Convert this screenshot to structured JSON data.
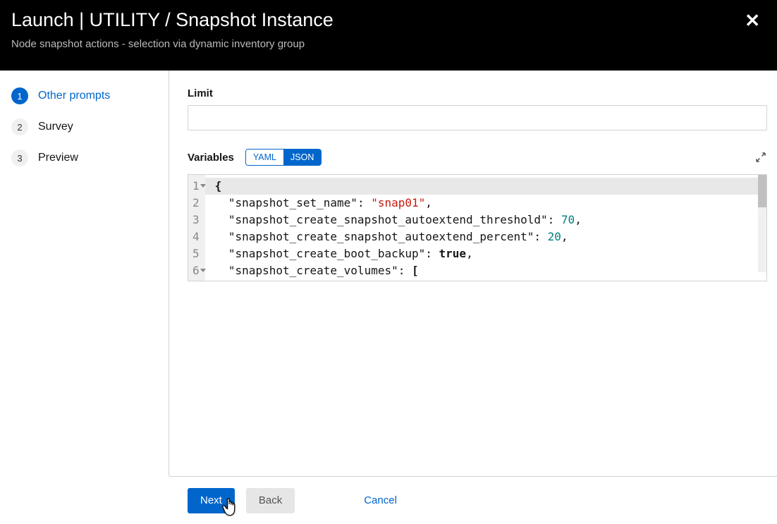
{
  "header": {
    "title": "Launch | UTILITY / Snapshot Instance",
    "subtitle": "Node snapshot actions - selection via dynamic inventory group",
    "close_icon": "✕"
  },
  "sidebar": {
    "steps": [
      {
        "num": "1",
        "label": "Other prompts",
        "active": true
      },
      {
        "num": "2",
        "label": "Survey",
        "active": false
      },
      {
        "num": "3",
        "label": "Preview",
        "active": false
      }
    ]
  },
  "fields": {
    "limit_label": "Limit",
    "limit_value": "",
    "variables_label": "Variables",
    "toggle_yaml": "YAML",
    "toggle_json": "JSON"
  },
  "chart_data": {
    "type": "table",
    "title": "Variables JSON editor",
    "language": "json",
    "raw": "{\n  \"snapshot_set_name\": \"snap01\",\n  \"snapshot_create_snapshot_autoextend_threshold\": 70,\n  \"snapshot_create_snapshot_autoextend_percent\": 20,\n  \"snapshot_create_boot_backup\": true,\n  \"snapshot_create_volumes\": [",
    "lines": [
      {
        "n": 1,
        "fold": true,
        "tokens": [
          {
            "t": "punct",
            "v": "{"
          }
        ]
      },
      {
        "n": 2,
        "fold": false,
        "tokens": [
          {
            "t": "indent",
            "v": "  "
          },
          {
            "t": "str-key",
            "v": "\"snapshot_set_name\""
          },
          {
            "t": "plain",
            "v": ": "
          },
          {
            "t": "str-val",
            "v": "\"snap01\""
          },
          {
            "t": "plain",
            "v": ","
          }
        ]
      },
      {
        "n": 3,
        "fold": false,
        "tokens": [
          {
            "t": "indent",
            "v": "  "
          },
          {
            "t": "str-key",
            "v": "\"snapshot_create_snapshot_autoextend_threshold\""
          },
          {
            "t": "plain",
            "v": ": "
          },
          {
            "t": "num",
            "v": "70"
          },
          {
            "t": "plain",
            "v": ","
          }
        ]
      },
      {
        "n": 4,
        "fold": false,
        "tokens": [
          {
            "t": "indent",
            "v": "  "
          },
          {
            "t": "str-key",
            "v": "\"snapshot_create_snapshot_autoextend_percent\""
          },
          {
            "t": "plain",
            "v": ": "
          },
          {
            "t": "num",
            "v": "20"
          },
          {
            "t": "plain",
            "v": ","
          }
        ]
      },
      {
        "n": 5,
        "fold": false,
        "tokens": [
          {
            "t": "indent",
            "v": "  "
          },
          {
            "t": "str-key",
            "v": "\"snapshot_create_boot_backup\""
          },
          {
            "t": "plain",
            "v": ": "
          },
          {
            "t": "bool",
            "v": "true"
          },
          {
            "t": "plain",
            "v": ","
          }
        ]
      },
      {
        "n": 6,
        "fold": true,
        "tokens": [
          {
            "t": "indent",
            "v": "  "
          },
          {
            "t": "str-key",
            "v": "\"snapshot_create_volumes\""
          },
          {
            "t": "plain",
            "v": ": "
          },
          {
            "t": "punct",
            "v": "["
          }
        ]
      }
    ]
  },
  "footer": {
    "next": "Next",
    "back": "Back",
    "cancel": "Cancel"
  }
}
